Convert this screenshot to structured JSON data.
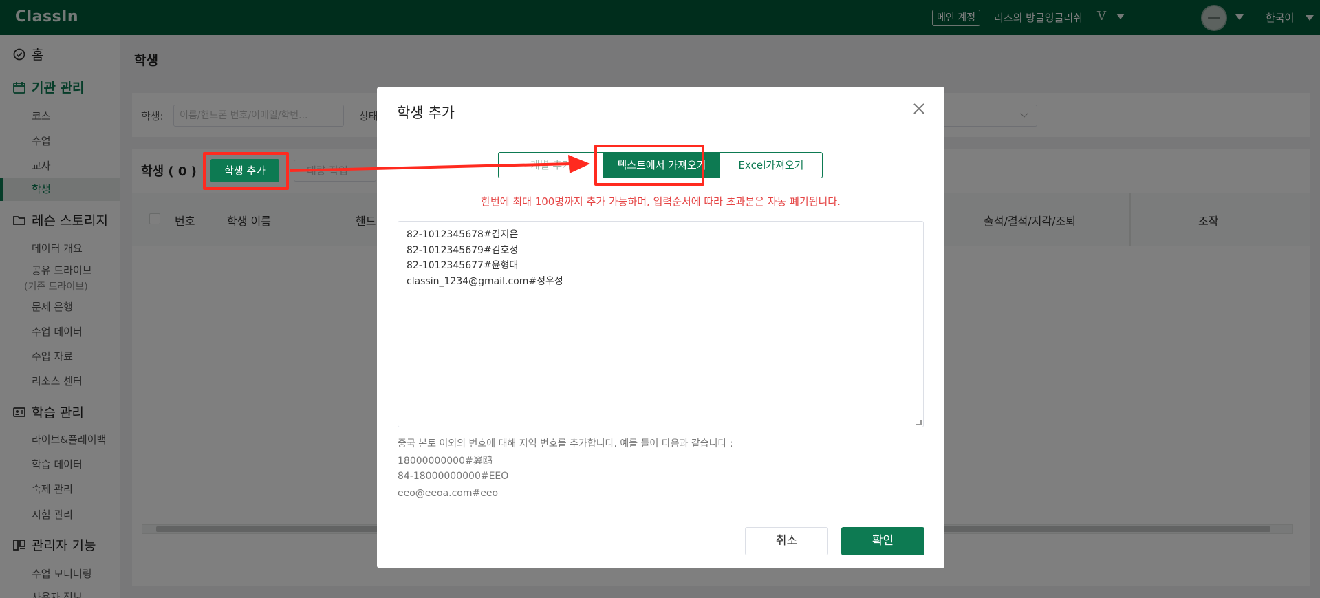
{
  "topbar": {
    "logo": "ClassIn",
    "account_badge": "메인 계정",
    "org_name": "리즈의 방글잉글리쉬",
    "org_mark": "V",
    "language": "한국어"
  },
  "sidebar": {
    "home": "홈",
    "org_manage": "기관 관리",
    "org_items": [
      "코스",
      "수업",
      "교사",
      "학생"
    ],
    "lesson_story": "레슨 스토리지",
    "lesson_items": [
      "데이터 개요",
      "공유 드라이브",
      "문제 은행",
      "수업 데이터",
      "수업 자료",
      "리소스 센터"
    ],
    "lesson_sub_note": "(기존 드라이브)",
    "study_manage": "학습 관리",
    "study_items": [
      "라이브&플레이백",
      "학습 데이터",
      "숙제 관리",
      "시험 관리"
    ],
    "admin": "관리자 기능",
    "admin_items": [
      "수업 모니터링",
      "사용자 정보"
    ]
  },
  "main": {
    "page_title": "학생",
    "filter_student_label": "학생:",
    "filter_placeholder": "이름/핸드폰 번호/이메일/학번...",
    "filter_status_label": "상태",
    "list_title": "학생 ( 0 )",
    "add_student_button": "학생 추가",
    "bulk_action_button": "대량 작업",
    "table_headers": {
      "number": "번호",
      "student_name": "학생 이름",
      "phone": "핸드",
      "attendance": "출석/결석/지각/조퇴",
      "actions": "조작"
    }
  },
  "modal": {
    "title": "학생 추가",
    "tabs": [
      "개별 추가",
      "텍스트에서 가져오기",
      "Excel가져오기"
    ],
    "active_tab": "텍스트에서 가져오기",
    "warning": "한번에 최대 100명까지 추가 가능하며, 입력순서에 따라 초과분은 자동 폐기됩니다.",
    "textarea_lines": [
      "82-1012345678#김지은",
      "82-1012345679#김호성",
      "82-1012345677#윤형태",
      "classin_1234@gmail.com#정우성"
    ],
    "hint_lines": [
      "중국 본토 이외의 번호에 대해 지역 번호를 추가합니다. 예를 들어 다음과 같습니다 :",
      "18000000000#翼鸥",
      "84-18000000000#EEO",
      "eeo@eeoa.com#eeo"
    ],
    "cancel_button": "취소",
    "confirm_button": "확인"
  },
  "colors": {
    "brand_green": "#005a38",
    "accent_green": "#0d7a52",
    "warning_red": "#e54545",
    "annotation_red": "#ff2a1f"
  }
}
